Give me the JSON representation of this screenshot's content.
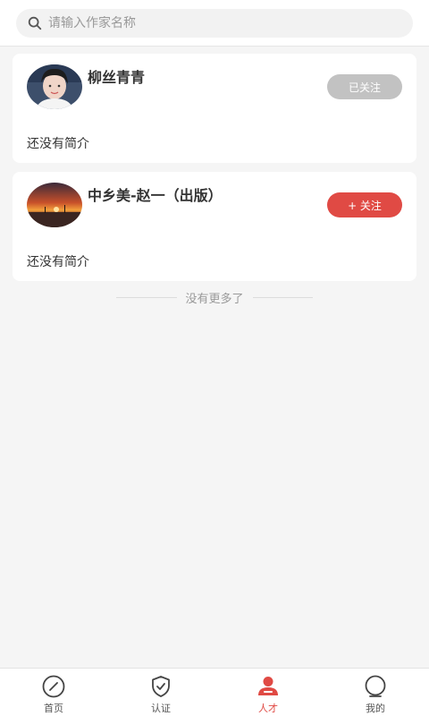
{
  "search": {
    "placeholder": "请输入作家名称"
  },
  "authors": [
    {
      "name": "柳丝青青",
      "bio": "还没有简介",
      "follow_label": "已关注",
      "followed": true
    },
    {
      "name": "中乡美-赵一（出版）",
      "bio": "还没有简介",
      "follow_label": "+ 关注",
      "followed": false
    }
  ],
  "list_end_text": "没有更多了",
  "tabs": [
    {
      "label": "首页",
      "icon": "compass-icon",
      "active": false
    },
    {
      "label": "认证",
      "icon": "shield-check-icon",
      "active": false
    },
    {
      "label": "人才",
      "icon": "person-icon",
      "active": true
    },
    {
      "label": "我的",
      "icon": "profile-circle-icon",
      "active": false
    }
  ],
  "colors": {
    "accent": "#e04a44",
    "followed_button": "#c2c2c2",
    "background": "#f5f5f5"
  }
}
